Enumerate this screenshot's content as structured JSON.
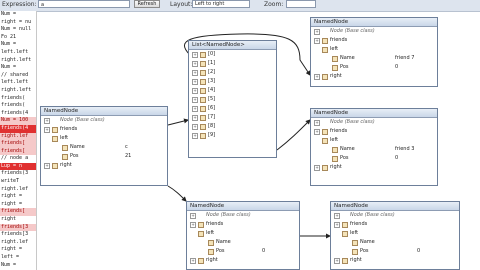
{
  "toolbar": {
    "expression_label": "Expression:",
    "expression_value": "a",
    "refresh_label": "Refresh",
    "layout_label": "Layout:",
    "layout_value": "Left to right",
    "zoom_label": "Zoom:"
  },
  "code_lines": [
    {
      "text": "Num = ",
      "hl": false
    },
    {
      "text": "right = nu",
      "hl": false
    },
    {
      "text": "Num = null",
      "hl": false
    },
    {
      "text": "Fo      21",
      "hl": false
    },
    {
      "text": "Num = ",
      "hl": false
    },
    {
      "text": "left.left",
      "hl": false
    },
    {
      "text": "right.left",
      "hl": false
    },
    {
      "text": "Num = ",
      "hl": false
    },
    {
      "text": "// shared",
      "hl": false
    },
    {
      "text": "left.left",
      "hl": false
    },
    {
      "text": "right.left",
      "hl": false
    },
    {
      "text": "friends(",
      "hl": false
    },
    {
      "text": "friends(",
      "hl": false
    },
    {
      "text": "friends(4",
      "hl": false
    },
    {
      "text": "Num = 100",
      "hl": true
    },
    {
      "text": "friends(4",
      "hl": "cur"
    },
    {
      "text": "right.lef",
      "hl": true
    },
    {
      "text": "friends[",
      "hl": true
    },
    {
      "text": "friends[",
      "hl": true
    },
    {
      "text": "// node a",
      "hl": false
    },
    {
      "text": "Lup = n",
      "hl": "cur"
    },
    {
      "text": "friends(3",
      "hl": false
    },
    {
      "text": "writeT",
      "hl": false
    },
    {
      "text": "right.lef",
      "hl": false
    },
    {
      "text": "right = ",
      "hl": false
    },
    {
      "text": "right = ",
      "hl": false
    },
    {
      "text": "friends[",
      "hl": true
    },
    {
      "text": "right",
      "hl": false
    },
    {
      "text": "friends[3",
      "hl": true
    },
    {
      "text": "friends[3",
      "hl": false
    },
    {
      "text": "right.lef",
      "hl": false
    },
    {
      "text": "right = ",
      "hl": false
    },
    {
      "text": "left = ",
      "hl": false
    },
    {
      "text": "Num = ",
      "hl": false
    }
  ],
  "nodes": {
    "main": {
      "title": "NamedNode",
      "rows": [
        {
          "text": "Node (Base class)",
          "expander": "+",
          "icon": false,
          "italic": true
        },
        {
          "text": "friends",
          "expander": "+",
          "icon": true
        },
        {
          "text": "left",
          "expander": "",
          "icon": true
        },
        {
          "text": "Name",
          "expander": "",
          "icon": true,
          "value": "c",
          "indent": true
        },
        {
          "text": "Pos",
          "expander": "",
          "icon": true,
          "value": "21",
          "indent": true
        },
        {
          "text": "right",
          "expander": "+",
          "icon": true
        }
      ]
    },
    "list": {
      "title": "List<NamedNode>",
      "rows": [
        {
          "text": "[0]",
          "expander": "+",
          "icon": true
        },
        {
          "text": "[1]",
          "expander": "+",
          "icon": true
        },
        {
          "text": "[2]",
          "expander": "+",
          "icon": true
        },
        {
          "text": "[3]",
          "expander": "+",
          "icon": true
        },
        {
          "text": "[4]",
          "expander": "+",
          "icon": true
        },
        {
          "text": "[5]",
          "expander": "+",
          "icon": true
        },
        {
          "text": "[6]",
          "expander": "+",
          "icon": true
        },
        {
          "text": "[7]",
          "expander": "+",
          "icon": true
        },
        {
          "text": "[8]",
          "expander": "+",
          "icon": true
        },
        {
          "text": "[9]",
          "expander": "+",
          "icon": true
        }
      ]
    },
    "top_right": {
      "title": "NamedNode",
      "rows": [
        {
          "text": "Node (Base class)",
          "expander": "+",
          "icon": false,
          "italic": true
        },
        {
          "text": "friends",
          "expander": "+",
          "icon": true
        },
        {
          "text": "left",
          "expander": "",
          "icon": true
        },
        {
          "text": "Name",
          "expander": "",
          "icon": true,
          "value": "friend 7",
          "indent": true
        },
        {
          "text": "Pos",
          "expander": "",
          "icon": true,
          "value": "0",
          "indent": true
        },
        {
          "text": "right",
          "expander": "+",
          "icon": true
        }
      ]
    },
    "mid_right": {
      "title": "NamedNode",
      "rows": [
        {
          "text": "Node (Base class)",
          "expander": "+",
          "icon": false,
          "italic": true
        },
        {
          "text": "friends",
          "expander": "+",
          "icon": true
        },
        {
          "text": "left",
          "expander": "",
          "icon": true
        },
        {
          "text": "Name",
          "expander": "",
          "icon": true,
          "value": "friend 3",
          "indent": true
        },
        {
          "text": "Pos",
          "expander": "",
          "icon": true,
          "value": "0",
          "indent": true
        },
        {
          "text": "right",
          "expander": "+",
          "icon": true
        }
      ]
    },
    "bottom_mid": {
      "title": "NamedNode",
      "rows": [
        {
          "text": "Node (Base class)",
          "expander": "+",
          "icon": false,
          "italic": true
        },
        {
          "text": "friends",
          "expander": "+",
          "icon": true
        },
        {
          "text": "left",
          "expander": "",
          "icon": true
        },
        {
          "text": "Name",
          "expander": "",
          "icon": true,
          "value": "",
          "indent": true
        },
        {
          "text": "Pos",
          "expander": "",
          "icon": true,
          "value": "0",
          "indent": true
        },
        {
          "text": "right",
          "expander": "+",
          "icon": true
        }
      ]
    },
    "bottom_right": {
      "title": "NamedNode",
      "rows": [
        {
          "text": "Node (Base class)",
          "expander": "+",
          "icon": false,
          "italic": true
        },
        {
          "text": "friends",
          "expander": "+",
          "icon": true
        },
        {
          "text": "left",
          "expander": "",
          "icon": true
        },
        {
          "text": "Name",
          "expander": "",
          "icon": true,
          "value": "",
          "indent": true
        },
        {
          "text": "Pos",
          "expander": "",
          "icon": true,
          "value": "0",
          "indent": true
        },
        {
          "text": "right",
          "expander": "+",
          "icon": true
        }
      ]
    }
  }
}
